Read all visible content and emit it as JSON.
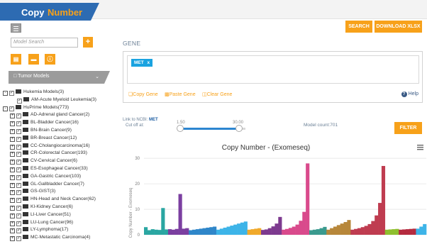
{
  "header": {
    "logo_part1": "Copy",
    "logo_part2": "Number"
  },
  "sidebar": {
    "search_placeholder": "Model Search",
    "add_label": "+",
    "tumor_models_label": "Tumor Models",
    "tree": [
      {
        "label": "Hukemia Models(3)",
        "level": 0,
        "expander": "-"
      },
      {
        "label": "AM-Acute Myeloid Leukemia(3)",
        "level": 1,
        "expander": ""
      },
      {
        "label": "HuPrime Models(773)",
        "level": 0,
        "expander": "-"
      },
      {
        "label": "AD-Adrenal gland Cancer(2)",
        "level": 1,
        "expander": "+"
      },
      {
        "label": "BL-Bladder Cancer(16)",
        "level": 1,
        "expander": "+"
      },
      {
        "label": "BN-Brain Cancer(9)",
        "level": 1,
        "expander": "+"
      },
      {
        "label": "BR-Breast Cancer(12)",
        "level": 1,
        "expander": "+"
      },
      {
        "label": "CC-Cholangiocarcinoma(16)",
        "level": 1,
        "expander": "+"
      },
      {
        "label": "CR-Colorectal Cancer(193)",
        "level": 1,
        "expander": "+"
      },
      {
        "label": "CV-Cervical Cancer(6)",
        "level": 1,
        "expander": "+"
      },
      {
        "label": "ES-Esophageal Cancer(33)",
        "level": 1,
        "expander": "+"
      },
      {
        "label": "GA-Gastric Cancer(103)",
        "level": 1,
        "expander": "+"
      },
      {
        "label": "GL-Gallbladder Cancer(7)",
        "level": 1,
        "expander": "+"
      },
      {
        "label": "GS-GIST(3)",
        "level": 1,
        "expander": "+"
      },
      {
        "label": "HN-Head and Neck Cancer(62)",
        "level": 1,
        "expander": "+"
      },
      {
        "label": "KI-Kidney Cancer(6)",
        "level": 1,
        "expander": "+"
      },
      {
        "label": "LI-Liver Cancer(51)",
        "level": 1,
        "expander": "+"
      },
      {
        "label": "LU-Lung Cancer(96)",
        "level": 1,
        "expander": "+"
      },
      {
        "label": "LY-Lymphoma(17)",
        "level": 1,
        "expander": "+"
      },
      {
        "label": "MC-Metastatic Carcinoma(4)",
        "level": 1,
        "expander": "+"
      }
    ]
  },
  "toolbar": {
    "search_label": "SEARCH",
    "download_label": "DOWNLOAD XLSX"
  },
  "gene": {
    "title": "GENE",
    "tags": [
      "MET"
    ],
    "tag_remove": "x",
    "copy_label": "Copy Gene",
    "paste_label": "Paste Gene",
    "clear_label": "Clear Gene",
    "help_label": "Help"
  },
  "filter": {
    "ncbi_prefix": "Link to NCBI:",
    "ncbi_gene": "MET",
    "cutoff_label": "Cut off at:",
    "slider_min": "1.50",
    "slider_max": "30.00",
    "model_count": "Model count:701",
    "filter_label": "FILTER"
  },
  "colors": {
    "accent": "#f7a11a",
    "brand": "#2d6bb2",
    "tag": "#1aa3e0"
  },
  "chart_data": {
    "type": "bar",
    "title": "Copy Number - (Exomeseq)",
    "ylabel": "Copy Number - Exomeseq",
    "yticks": [
      "0",
      "10",
      "20",
      "30"
    ],
    "ylim": [
      0,
      32
    ],
    "menu_icon": "hamburger-icon",
    "series": [
      {
        "color": "#2aa6a2",
        "values": [
          3.0,
          1.8,
          2.2,
          2.0,
          1.9,
          10.5,
          2.1
        ]
      },
      {
        "color": "#7b3fa0",
        "values": [
          2.2,
          2.0,
          2.3,
          16.0,
          2.4,
          2.6
        ]
      },
      {
        "color": "#2f86c9",
        "values": [
          1.8,
          2.0,
          2.2,
          2.4,
          2.6,
          2.8,
          3.0,
          3.2
        ]
      },
      {
        "color": "#3db4e8",
        "values": [
          2.0,
          2.4,
          2.8,
          3.2,
          3.6,
          4.0,
          4.4,
          4.8,
          5.2
        ]
      },
      {
        "color": "#f0a92b",
        "values": [
          2.0,
          2.2,
          2.4,
          2.6
        ]
      },
      {
        "color": "#7d3a8f",
        "values": [
          1.9,
          2.1,
          2.6,
          3.3,
          4.4,
          7.0
        ]
      },
      {
        "color": "#d94a8c",
        "values": [
          2.0,
          2.3,
          2.7,
          3.2,
          4.0,
          5.5,
          9.0,
          28.0
        ]
      },
      {
        "color": "#3a9a8e",
        "values": [
          1.8,
          2.0,
          2.2,
          2.6,
          3.1
        ]
      },
      {
        "color": "#b7873a",
        "values": [
          2.0,
          2.6,
          3.2,
          3.8,
          4.4,
          5.0,
          5.8
        ]
      },
      {
        "color": "#bf3c50",
        "values": [
          2.0,
          2.3,
          2.6,
          3.0,
          3.5,
          4.2,
          5.4,
          7.6,
          12.5,
          27.0
        ]
      },
      {
        "color": "#8fbf2f",
        "values": [
          2.0,
          2.1,
          2.2,
          2.3
        ]
      },
      {
        "color": "#b52b3f",
        "values": [
          2.0,
          2.1,
          2.2,
          2.3,
          2.4
        ]
      },
      {
        "color": "#3db4e8",
        "values": [
          2.4,
          3.2,
          4.2
        ]
      }
    ]
  }
}
